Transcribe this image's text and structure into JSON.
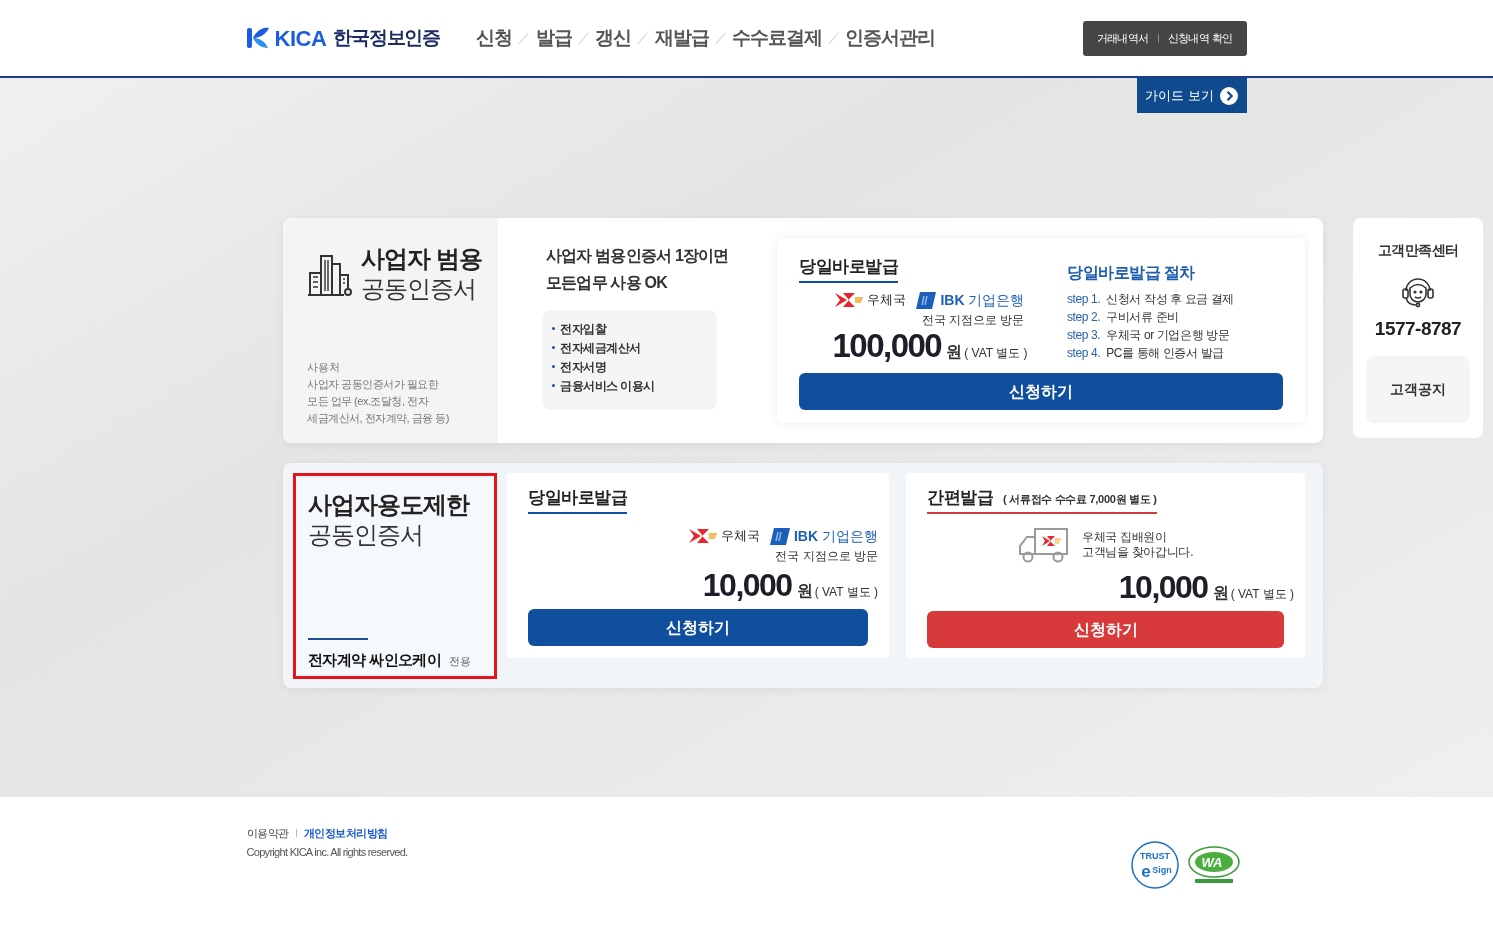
{
  "header": {
    "logo": {
      "brand": "KICA",
      "name": "한국정보인증"
    },
    "nav": [
      {
        "label": "신청"
      },
      {
        "label": "발급"
      },
      {
        "label": "갱신"
      },
      {
        "label": "재발급"
      },
      {
        "label": "수수료결제"
      },
      {
        "label": "인증서관리"
      }
    ],
    "history_links": [
      {
        "label": "거래내역서"
      },
      {
        "label": "신청내역 확인"
      }
    ]
  },
  "guide_button": {
    "label": "가이드 보기"
  },
  "universal_card": {
    "title_bold": "사업자 범용",
    "title": "공동인증서",
    "usage_heading": "사용처",
    "usage_lines": [
      "사업자 공동인증서가 필요한",
      "모든 업무 (ex.조달청, 전자",
      "세금계산서, 전자계약, 금융 등)"
    ],
    "headline_lines": [
      "사업자 범용인증서 1장이면",
      "모든업무 사용 OK"
    ],
    "uses": [
      "전자입찰",
      "전자세금계산서",
      "전자서명",
      "금융서비스 이용시"
    ],
    "offer": {
      "title": "당일바로발급",
      "partners": [
        {
          "kind": "post",
          "label": "우체국"
        },
        {
          "kind": "bank",
          "label": "**IBK** 기업은행"
        }
      ],
      "note": "전국 지점으로 방문",
      "price": "100,000",
      "unit": "원",
      "vat": "( VAT 별도 )",
      "button": "신청하기"
    },
    "steps_title": "당일바로발급 절차",
    "steps": [
      {
        "label": "step 1.",
        "text": "신청서 작성 후 요금 결제"
      },
      {
        "label": "step 2.",
        "text": "구비서류 준비"
      },
      {
        "label": "step 3.",
        "text": "우체국 or 기업은행 방문"
      },
      {
        "label": "step 4.",
        "text": "PC를 통해 인증서 발급"
      }
    ]
  },
  "restricted_card": {
    "highlighted": true,
    "title_bold": "사업자용도제한",
    "title": "공동인증서",
    "service": "전자계약 싸인오케이",
    "service_note": "전용",
    "offers": [
      {
        "kind": "visit",
        "color": "#104f9e",
        "title": "당일바로발급",
        "partners": [
          {
            "kind": "post",
            "label": "우체국"
          },
          {
            "kind": "bank",
            "label": "**IBK** 기업은행"
          }
        ],
        "note": "전국 지점으로 방문",
        "price": "10,000",
        "unit": "원",
        "vat": "( VAT 별도 )",
        "button": "신청하기"
      },
      {
        "kind": "courier",
        "color": "#d8393a",
        "title": "간편발급",
        "title_note": "( 서류접수 수수료 7,000원 별도 )",
        "courier_lines": [
          "우체국 집배원이",
          "고객님을 찾아갑니다."
        ],
        "price": "10,000",
        "unit": "원",
        "vat": "( VAT 별도 )",
        "button": "신청하기"
      }
    ]
  },
  "customer_center": {
    "title": "고객만족센터",
    "phone": "1577-8787",
    "notice_button": "고객공지"
  },
  "footer": {
    "links": [
      {
        "label": "이용약관",
        "emphasis": false
      },
      {
        "label": "개인정보처리방침",
        "emphasis": true
      }
    ],
    "copyright": "Copyright KICA inc. All rights reserved.",
    "marks": [
      {
        "kind": "esign",
        "top": "TRUST",
        "letter": "e",
        "sub": "Sign"
      },
      {
        "kind": "wa",
        "label": "WA"
      }
    ]
  }
}
